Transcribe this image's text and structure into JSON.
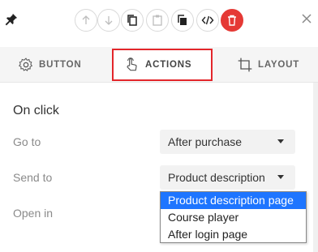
{
  "toolbar": {
    "icons": [
      "pin-icon",
      "move-up-icon",
      "move-down-icon",
      "copy-icon",
      "paste-icon",
      "duplicate-icon",
      "code-icon",
      "delete-icon",
      "close-icon"
    ]
  },
  "tabs": [
    {
      "label": "BUTTON",
      "icon": "gear-icon"
    },
    {
      "label": "ACTIONS",
      "icon": "pointer-hand-icon",
      "active": true
    },
    {
      "label": "LAYOUT",
      "icon": "crop-icon"
    }
  ],
  "section": {
    "title": "On click"
  },
  "fields": {
    "go_to": {
      "label": "Go to",
      "value": "After purchase"
    },
    "send_to": {
      "label": "Send to",
      "value": "Product description"
    },
    "open_in": {
      "label": "Open in"
    }
  },
  "dropdown": {
    "options": [
      "Product description page",
      "Course player",
      "After login page"
    ],
    "selected_index": 0
  },
  "colors": {
    "accent_red": "#e3262b",
    "delete_red": "#e53935",
    "selection_blue": "#1e75ff"
  }
}
